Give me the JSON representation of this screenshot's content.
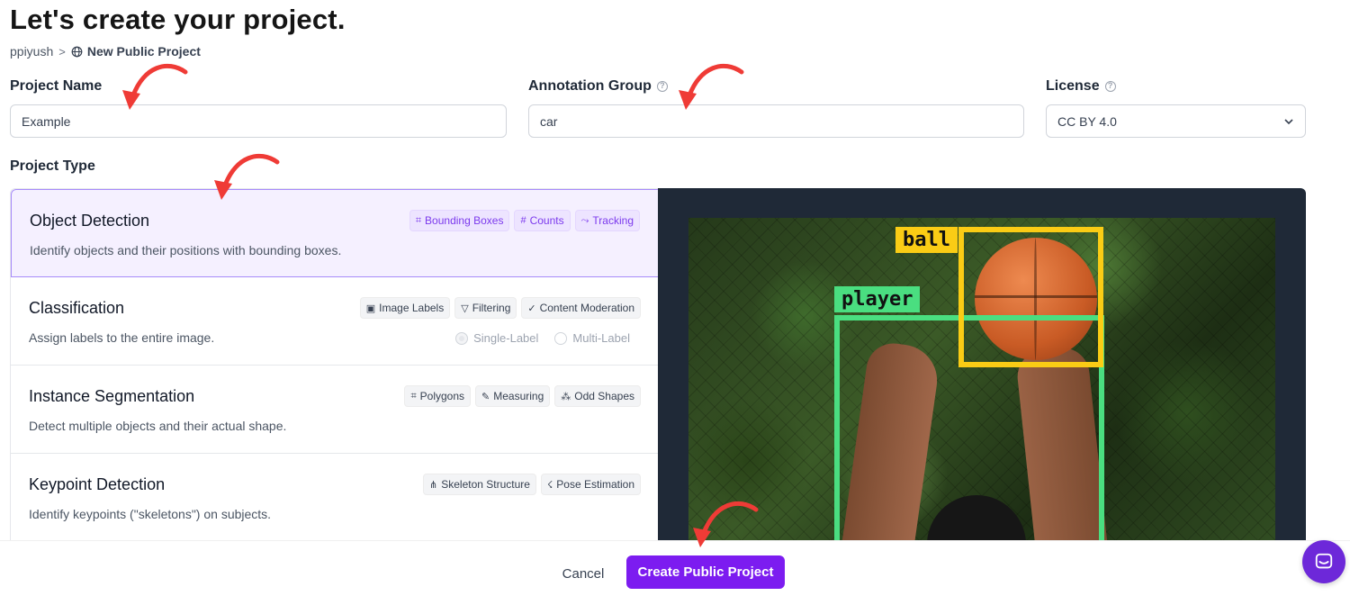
{
  "page": {
    "title": "Let's create your project.",
    "breadcrumb": {
      "user": "ppiyush",
      "separator": ">",
      "current": "New Public Project",
      "current_icon": "globe-icon"
    }
  },
  "form": {
    "project_name": {
      "label": "Project Name",
      "value": "Example"
    },
    "annotation_group": {
      "label": "Annotation Group",
      "value": "car",
      "help_icon": "help-circle-icon"
    },
    "license": {
      "label": "License",
      "value": "CC BY 4.0",
      "help_icon": "help-circle-icon",
      "dropdown_icon": "chevron-down-icon"
    }
  },
  "project_type": {
    "label": "Project Type",
    "types": [
      {
        "title": "Object Detection",
        "description": "Identify objects and their positions with bounding boxes.",
        "selected": true,
        "tags": [
          {
            "icon": "bounding-box-icon",
            "glyph": "⌗",
            "label": "Bounding Boxes"
          },
          {
            "icon": "hash-icon",
            "glyph": "#",
            "label": "Counts"
          },
          {
            "icon": "tracking-icon",
            "glyph": "⤳",
            "label": "Tracking"
          }
        ]
      },
      {
        "title": "Classification",
        "description": "Assign labels to the entire image.",
        "selected": false,
        "tags": [
          {
            "icon": "image-icon",
            "glyph": "▣",
            "label": "Image Labels"
          },
          {
            "icon": "filter-icon",
            "glyph": "▽",
            "label": "Filtering"
          },
          {
            "icon": "check-icon",
            "glyph": "✓",
            "label": "Content Moderation"
          }
        ],
        "options": [
          {
            "label": "Single-Label",
            "selected": true
          },
          {
            "label": "Multi-Label",
            "selected": false
          }
        ]
      },
      {
        "title": "Instance Segmentation",
        "description": "Detect multiple objects and their actual shape.",
        "selected": false,
        "tags": [
          {
            "icon": "polygon-icon",
            "glyph": "⌗",
            "label": "Polygons"
          },
          {
            "icon": "ruler-icon",
            "glyph": "✎",
            "label": "Measuring"
          },
          {
            "icon": "shapes-icon",
            "glyph": "⁂",
            "label": "Odd Shapes"
          }
        ]
      },
      {
        "title": "Keypoint Detection",
        "description": "Identify keypoints (\"skeletons\") on subjects.",
        "selected": false,
        "tags": [
          {
            "icon": "skeleton-icon",
            "glyph": "⋔",
            "label": "Skeleton Structure"
          },
          {
            "icon": "pose-icon",
            "glyph": "☇",
            "label": "Pose Estimation"
          }
        ]
      }
    ]
  },
  "preview": {
    "labels": {
      "ball": "ball",
      "player": "player"
    },
    "colors": {
      "ball": "#facc15",
      "player": "#4ade80"
    }
  },
  "footer": {
    "cancel_label": "Cancel",
    "create_label": "Create Public Project"
  },
  "chat": {
    "icon": "chat-icon"
  },
  "colors": {
    "accent": "#7c1cf0",
    "selected_bg": "#f5f0ff",
    "annotation_arrow": "#ef3b36"
  }
}
